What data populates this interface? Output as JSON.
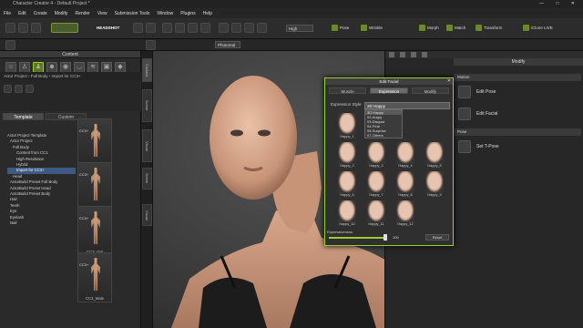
{
  "window": {
    "title": "Character Creator 4 - Default Project *",
    "controls": "— □ ✕"
  },
  "menu": [
    "File",
    "Edit",
    "Create",
    "Modify",
    "Render",
    "View",
    "Submission Tools",
    "Window",
    "Plugins",
    "Help"
  ],
  "toolbar": {
    "quality_select": "High",
    "pose_label": "Pose",
    "wrinkle_label": "Wrinkle",
    "morph_label": "Morph",
    "match_label": "Match",
    "headshot_label": "HEADSHOT",
    "transform_label": "Transform",
    "preset_select": "Photoreal",
    "export_label": "iClone LIVE"
  },
  "content": {
    "title": "Content",
    "breadcrumb": "Actor Project  ›  Full Body  ›  Import for CC3+",
    "tabs": [
      "Template",
      "Custom"
    ],
    "active_tab": "Template",
    "tree": [
      {
        "label": "Actor Project Template",
        "selected": false
      },
      {
        "label": "Actor Project",
        "selected": false
      },
      {
        "label": "Full Body",
        "selected": false
      },
      {
        "label": "Content from CC1",
        "selected": false
      },
      {
        "label": "High Resolution",
        "selected": false
      },
      {
        "label": "Hybrid",
        "selected": false
      },
      {
        "label": "Import for CC3+",
        "selected": true
      },
      {
        "label": "Head",
        "selected": false
      },
      {
        "label": "ActorBuild Preset Full Body",
        "selected": false
      },
      {
        "label": "ActorBuild Preset Head",
        "selected": false
      },
      {
        "label": "ActorBuild Preset Body",
        "selected": false
      },
      {
        "label": "Hair",
        "selected": false
      },
      {
        "label": "Teeth",
        "selected": false
      },
      {
        "label": "Eye",
        "selected": false
      },
      {
        "label": "Eyelash",
        "selected": false
      },
      {
        "label": "Nail",
        "selected": false
      }
    ],
    "thumbs": [
      {
        "label": "CC3_Base Female",
        "tag": "CC3+"
      },
      {
        "label": "CC3_Base Male",
        "tag": "CC3+"
      },
      {
        "label": "CC3_Girl",
        "tag": "CC3+"
      },
      {
        "label": "CC3_Male",
        "tag": "CC3+"
      }
    ]
  },
  "side_tabs": [
    "Content",
    "Scene",
    "Visual",
    "Scene",
    "Visual"
  ],
  "modify": {
    "title": "Modify",
    "section1": "Motion",
    "edit_pose": "Edit Pose",
    "edit_facial": "Edit Facial",
    "section2": "Pose",
    "tpose": "Set T-Pose"
  },
  "facial_dialog": {
    "title": "Edit Facial",
    "close": "✕",
    "tabs": [
      "Muscle",
      "Expression",
      "Modify"
    ],
    "active_tab": "Expression",
    "style_label": "Expression Style",
    "style_value": "2D Happy",
    "style_options": [
      "3D Happy",
      "02-Angry",
      "03-Disgust",
      "04-Fear",
      "05-Surprise",
      "07-Others"
    ],
    "first_face": "Happy_1",
    "faces": [
      "Happy_2",
      "Happy_3",
      "Happy_4",
      "Happy_5",
      "Happy_6",
      "Happy_7",
      "Happy_8",
      "Happy_9",
      "Happy_10",
      "Happy_11",
      "Happy_12"
    ],
    "strength_label": "Expressiveness",
    "strength_value": "100",
    "reset_label": "Reset"
  },
  "colors": {
    "accent": "#9acd32",
    "selection": "#3d5a85"
  }
}
